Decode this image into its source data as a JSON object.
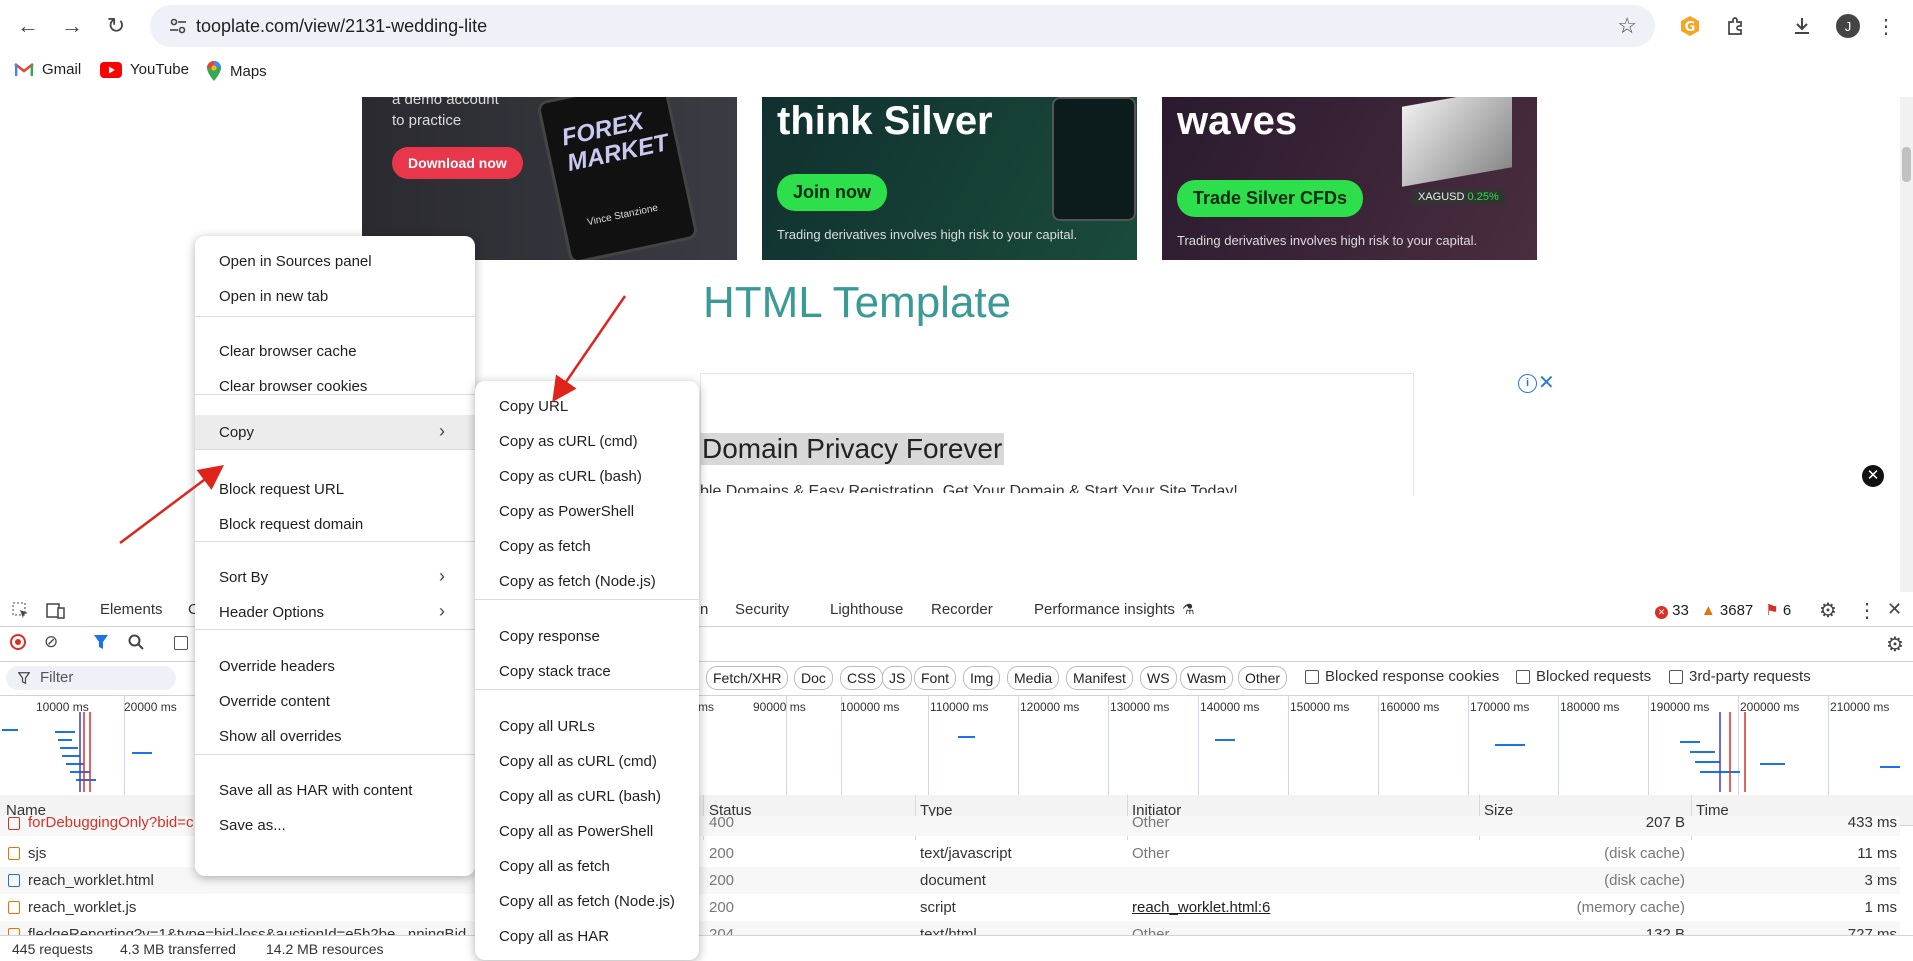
{
  "browser": {
    "url": "tooplate.com/view/2131-wedding-lite",
    "profile_initial": "J",
    "bookmarks": [
      {
        "label": "Gmail",
        "icon": "gmail-icon"
      },
      {
        "label": "YouTube",
        "icon": "youtube-icon"
      },
      {
        "label": "Maps",
        "icon": "maps-icon"
      }
    ]
  },
  "page": {
    "ad1": {
      "line1": "a demo account",
      "line2": "to practice",
      "button": "Download now",
      "book_title": "FOREX MARKET",
      "author": "Vince Stanzione"
    },
    "ad2": {
      "headline": "think Silver",
      "button": "Join now",
      "disclaimer": "Trading derivatives involves high risk to your capital."
    },
    "ad3": {
      "headline": "waves",
      "button": "Trade Silver CFDs",
      "ticker": "XAGUSD",
      "change": "0.25%",
      "disclaimer": "Trading derivatives involves high risk to your capital."
    },
    "hero_title": "HTML Template",
    "ad_banner": {
      "title": "Domain Privacy Forever",
      "subtitle": "ble Domains & Easy Registration. Get Your Domain & Start Your Site Today!"
    }
  },
  "devtools": {
    "tabs": [
      "Elements",
      "C",
      "n",
      "Security",
      "Lighthouse",
      "Recorder",
      "Performance insights"
    ],
    "errors": "33",
    "warnings": "3687",
    "issues": "6",
    "filter_placeholder": "Filter",
    "type_filters": [
      "Fetch/XHR",
      "Doc",
      "CSS",
      "JS",
      "Font",
      "Img",
      "Media",
      "Manifest",
      "WS",
      "Wasm",
      "Other"
    ],
    "checkboxes": [
      "Blocked response cookies",
      "Blocked requests",
      "3rd-party requests"
    ],
    "timeline_ticks": [
      "10000 ms",
      "20000 ms",
      "ms",
      "90000 ms",
      "100000 ms",
      "110000 ms",
      "120000 ms",
      "130000 ms",
      "140000 ms",
      "150000 ms",
      "160000 ms",
      "170000 ms",
      "180000 ms",
      "190000 ms",
      "200000 ms",
      "210000 ms"
    ],
    "columns": [
      "Name",
      "Status",
      "Type",
      "Initiator",
      "Size",
      "Time"
    ],
    "rows": [
      {
        "name": "forDebuggingOnly?bid=c",
        "status": "400",
        "type": "",
        "initiator": "Other",
        "size": "207 B",
        "time": "433 ms",
        "error": true
      },
      {
        "name": "sjs",
        "status": "200",
        "type": "text/javascript",
        "initiator": "Other",
        "size": "(disk cache)",
        "time": "11 ms"
      },
      {
        "name": "reach_worklet.html",
        "status": "200",
        "type": "document",
        "initiator": "",
        "size": "(disk cache)",
        "time": "3 ms"
      },
      {
        "name": "reach_worklet.js",
        "status": "200",
        "type": "script",
        "initiator": "reach_worklet.html:6",
        "size": "(memory cache)",
        "time": "1 ms"
      },
      {
        "name": "fledgeReporting?v=1&type=bid-loss&auctionId=e5b2be...nningBid",
        "status": "204",
        "type": "text/html",
        "initiator": "Other",
        "size": "132 B",
        "time": "727 ms"
      }
    ],
    "status_bar": {
      "requests": "445 requests",
      "transferred": "4.3 MB transferred",
      "resources": "14.2 MB resources"
    }
  },
  "context_menu": {
    "items": [
      {
        "label": "Open in Sources panel"
      },
      {
        "label": "Open in new tab"
      },
      {
        "label": "Clear browser cache"
      },
      {
        "label": "Clear browser cookies"
      },
      {
        "label": "Copy"
      },
      {
        "label": "Block request URL"
      },
      {
        "label": "Block request domain"
      },
      {
        "label": "Sort By"
      },
      {
        "label": "Header Options"
      },
      {
        "label": "Override headers"
      },
      {
        "label": "Override content"
      },
      {
        "label": "Show all overrides"
      },
      {
        "label": "Save all as HAR with content"
      },
      {
        "label": "Save as..."
      }
    ]
  },
  "copy_submenu": {
    "items": [
      {
        "label": "Copy URL"
      },
      {
        "label": "Copy as cURL (cmd)"
      },
      {
        "label": "Copy as cURL (bash)"
      },
      {
        "label": "Copy as PowerShell"
      },
      {
        "label": "Copy as fetch"
      },
      {
        "label": "Copy as fetch (Node.js)"
      },
      {
        "label": "Copy response"
      },
      {
        "label": "Copy stack trace"
      },
      {
        "label": "Copy all URLs"
      },
      {
        "label": "Copy all as cURL (cmd)"
      },
      {
        "label": "Copy all as cURL (bash)"
      },
      {
        "label": "Copy all as PowerShell"
      },
      {
        "label": "Copy all as fetch"
      },
      {
        "label": "Copy all as fetch (Node.js)"
      },
      {
        "label": "Copy all as HAR"
      }
    ]
  },
  "colors": {
    "accent_teal": "#3a9a96",
    "annotation_arrow": "#e0241b",
    "link_blue": "#1a73e8"
  }
}
